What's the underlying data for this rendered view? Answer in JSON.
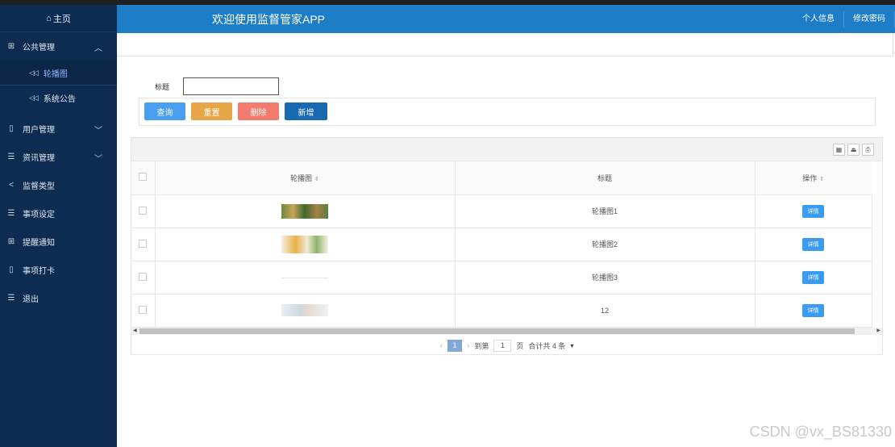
{
  "sidebar": {
    "home_label": "主页",
    "items": [
      {
        "label": "公共管理",
        "icon": "grid-icon",
        "expanded": true,
        "children": [
          {
            "label": "轮播图",
            "active": true
          },
          {
            "label": "系统公告",
            "active": false
          }
        ]
      },
      {
        "label": "用户管理",
        "icon": "book-icon"
      },
      {
        "label": "资讯管理",
        "icon": "list-icon"
      },
      {
        "label": "监督类型",
        "icon": "share-icon"
      },
      {
        "label": "事项设定",
        "icon": "list-icon"
      },
      {
        "label": "提醒通知",
        "icon": "grid-icon"
      },
      {
        "label": "事项打卡",
        "icon": "book-icon"
      },
      {
        "label": "退出",
        "icon": "list-icon"
      }
    ]
  },
  "header": {
    "title": "欢迎使用监督管家APP",
    "links": [
      "个人信息",
      "修改密码"
    ]
  },
  "search": {
    "title_label": "标题",
    "title_value": ""
  },
  "buttons": {
    "query": "查询",
    "reset": "重置",
    "delete": "删除",
    "add": "新增"
  },
  "table": {
    "columns": [
      "轮播图",
      "标题",
      "操作"
    ],
    "rows": [
      {
        "title": "轮播图1",
        "action": "详情"
      },
      {
        "title": "轮播图2",
        "action": "详情"
      },
      {
        "title": "轮播图3",
        "action": "详情"
      },
      {
        "title": "12",
        "action": "详情"
      }
    ]
  },
  "pager": {
    "current_page": "1",
    "goto_label": "到第",
    "goto_value": "1",
    "page_unit": "页",
    "total_label": "合计共 4 条"
  },
  "watermark": "CSDN @vx_BS81330",
  "colors": {
    "sidebar_bg": "#0e2c52",
    "header_bg": "#1d7dc6",
    "query": "#4a9ff0",
    "reset": "#e6a546",
    "delete": "#f47c6e",
    "add": "#1869b0"
  }
}
